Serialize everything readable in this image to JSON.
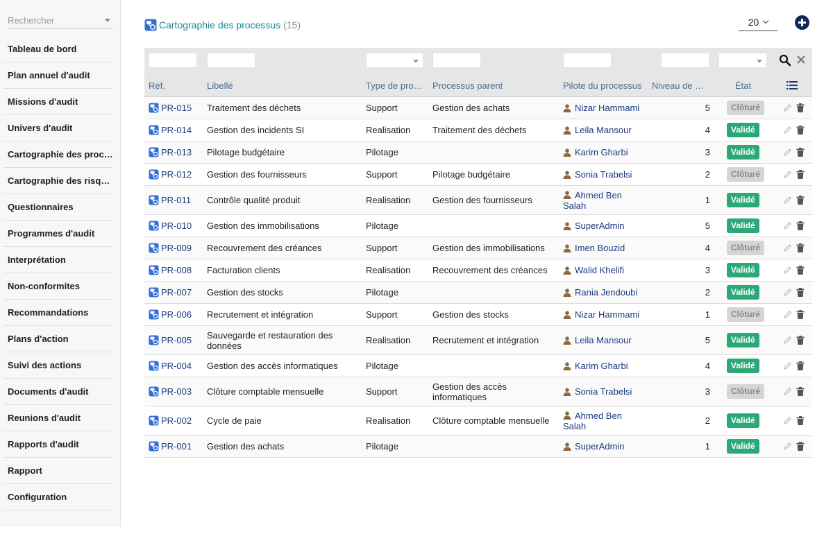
{
  "sidebar": {
    "search_placeholder": "Rechercher",
    "items": [
      {
        "label": "Tableau de bord"
      },
      {
        "label": "Plan annuel d'audit"
      },
      {
        "label": "Missions d'audit"
      },
      {
        "label": "Univers d'audit"
      },
      {
        "label": "Cartographie des processus"
      },
      {
        "label": "Cartographie des risques"
      },
      {
        "label": "Questionnaires"
      },
      {
        "label": "Programmes d'audit"
      },
      {
        "label": "Interprétation"
      },
      {
        "label": "Non-conformites"
      },
      {
        "label": "Recommandations"
      },
      {
        "label": "Plans d'action"
      },
      {
        "label": "Suivi des actions"
      },
      {
        "label": "Documents d'audit"
      },
      {
        "label": "Reunions d'audit"
      },
      {
        "label": "Rapports d'audit"
      },
      {
        "label": "Rapport"
      },
      {
        "label": "Configuration"
      }
    ]
  },
  "header": {
    "title": "Cartographie des processus",
    "count": "(15)",
    "page_size": "20"
  },
  "table": {
    "columns": {
      "ref": "Réf.",
      "libelle": "Libellé",
      "type": "Type de processus",
      "parent": "Processus parent",
      "pilote": "Pilote du processus",
      "niveau": "Niveau de maturité",
      "etat": "État"
    },
    "rows": [
      {
        "ref": "PR-015",
        "libelle": "Traitement des déchets",
        "type": "Support",
        "parent": "Gestion des achats",
        "pilote": "Nizar Hammami",
        "niveau": "5",
        "etat": "Clôturé",
        "tall": false
      },
      {
        "ref": "PR-014",
        "libelle": "Gestion des incidents SI",
        "type": "Realisation",
        "parent": "Traitement des déchets",
        "pilote": "Leila Mansour",
        "niveau": "4",
        "etat": "Validé",
        "tall": false
      },
      {
        "ref": "PR-013",
        "libelle": "Pilotage budgétaire",
        "type": "Pilotage",
        "parent": "",
        "pilote": "Karim Gharbi",
        "niveau": "3",
        "etat": "Validé",
        "tall": false
      },
      {
        "ref": "PR-012",
        "libelle": "Gestion des fournisseurs",
        "type": "Support",
        "parent": "Pilotage budgétaire",
        "pilote": "Sonia Trabelsi",
        "niveau": "2",
        "etat": "Clôturé",
        "tall": false
      },
      {
        "ref": "PR-011",
        "libelle": "Contrôle qualité produit",
        "type": "Realisation",
        "parent": "Gestion des fournisseurs",
        "pilote": "Ahmed Ben Salah",
        "niveau": "1",
        "etat": "Validé",
        "tall": true
      },
      {
        "ref": "PR-010",
        "libelle": "Gestion des immobilisations",
        "type": "Pilotage",
        "parent": "",
        "pilote": "SuperAdmin",
        "niveau": "5",
        "etat": "Validé",
        "tall": false
      },
      {
        "ref": "PR-009",
        "libelle": "Recouvrement des créances",
        "type": "Support",
        "parent": "Gestion des immobilisations",
        "pilote": "Imen Bouzid",
        "niveau": "4",
        "etat": "Clôturé",
        "tall": false
      },
      {
        "ref": "PR-008",
        "libelle": "Facturation clients",
        "type": "Realisation",
        "parent": "Recouvrement des créances",
        "pilote": "Walid Khelifi",
        "niveau": "3",
        "etat": "Validé",
        "tall": false
      },
      {
        "ref": "PR-007",
        "libelle": "Gestion des stocks",
        "type": "Pilotage",
        "parent": "",
        "pilote": "Rania Jendoubi",
        "niveau": "2",
        "etat": "Validé",
        "tall": false
      },
      {
        "ref": "PR-006",
        "libelle": "Recrutement et intégration",
        "type": "Support",
        "parent": "Gestion des stocks",
        "pilote": "Nizar Hammami",
        "niveau": "1",
        "etat": "Clôturé",
        "tall": false
      },
      {
        "ref": "PR-005",
        "libelle": "Sauvegarde et restauration des données",
        "type": "Realisation",
        "parent": "Recrutement et intégration",
        "pilote": "Leila Mansour",
        "niveau": "5",
        "etat": "Validé",
        "tall": true
      },
      {
        "ref": "PR-004",
        "libelle": "Gestion des accès informatiques",
        "type": "Pilotage",
        "parent": "",
        "pilote": "Karim Gharbi",
        "niveau": "4",
        "etat": "Validé",
        "tall": false
      },
      {
        "ref": "PR-003",
        "libelle": "Clôture comptable mensuelle",
        "type": "Support",
        "parent": "Gestion des accès informatiques",
        "pilote": "Sonia Trabelsi",
        "niveau": "3",
        "etat": "Clôturé",
        "tall": true
      },
      {
        "ref": "PR-002",
        "libelle": "Cycle de paie",
        "type": "Realisation",
        "parent": "Clôture comptable mensuelle",
        "pilote": "Ahmed Ben Salah",
        "niveau": "2",
        "etat": "Validé",
        "tall": true
      },
      {
        "ref": "PR-001",
        "libelle": "Gestion des achats",
        "type": "Pilotage",
        "parent": "",
        "pilote": "SuperAdmin",
        "niveau": "1",
        "etat": "Validé",
        "tall": false
      }
    ]
  },
  "colors": {
    "valide": "#2aa876",
    "cloture": "#d5d5d5",
    "title": "#1a8a98",
    "link": "#1a3a7c",
    "add_button": "#0f2a5b"
  },
  "icons": {
    "ref": "process-map-icon",
    "pilot": "user-icon",
    "edit": "pencil-icon",
    "delete": "trash-icon",
    "search": "search-icon",
    "clear": "close-icon",
    "columns": "list-columns-icon",
    "add": "plus-circle-icon"
  }
}
